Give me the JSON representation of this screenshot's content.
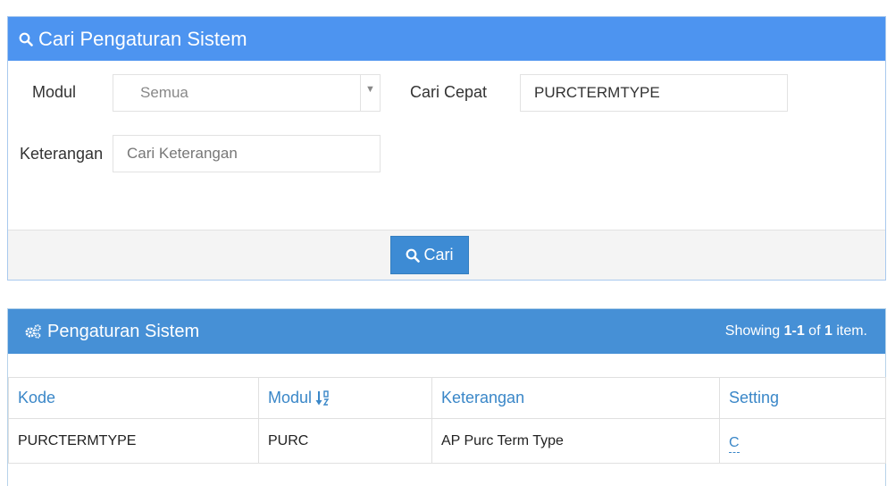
{
  "search_panel": {
    "title": "Cari Pengaturan Sistem",
    "modul_label": "Modul",
    "modul_value": "Semua",
    "cari_cepat_label": "Cari Cepat",
    "cari_cepat_value": "PURCTERMTYPE",
    "keterangan_label": "Keterangan",
    "keterangan_placeholder": "Cari Keterangan",
    "search_button_label": "Cari"
  },
  "result_panel": {
    "title": "Pengaturan Sistem",
    "summary_prefix": "Showing ",
    "summary_range": "1-1",
    "summary_mid": " of ",
    "summary_total": "1",
    "summary_suffix": " item.",
    "columns": [
      "Kode",
      "Modul",
      "Keterangan",
      "Setting"
    ],
    "rows": [
      {
        "kode": "PURCTERMTYPE",
        "modul": "PURC",
        "keterangan": "AP Purc Term Type",
        "setting": "C"
      }
    ]
  },
  "colors": {
    "search_header": "#4d94f0",
    "result_header": "#4690d6",
    "button": "#3d8bd4",
    "link": "#3a87c8"
  },
  "icons": {
    "search_header": "search-icon",
    "result_header": "cogs-icon",
    "sort": "sort-alpha-desc-icon"
  }
}
